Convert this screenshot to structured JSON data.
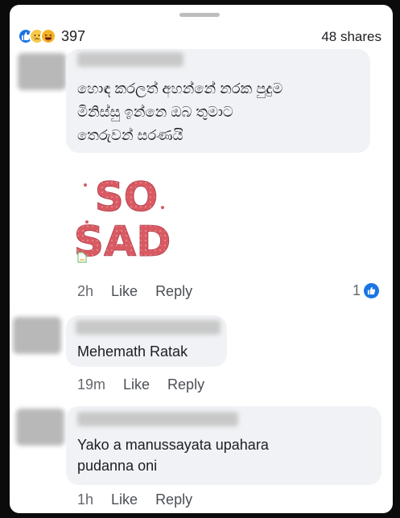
{
  "post": {
    "reaction_count": "397",
    "shares": "48 shares",
    "reaction_icons": [
      "like-icon",
      "sad-icon",
      "haha-icon"
    ]
  },
  "comments": [
    {
      "lines": [
        "හොඳ කරලත් අහන්නේ නරක පුදුම",
        "මිනිස්සු ඉන්නෙ ඔබ තුමාට",
        "තෙරුවන් සරණයි"
      ],
      "sticker_text": [
        "SO",
        "SAD"
      ],
      "time": "2h",
      "like": "Like",
      "reply": "Reply",
      "like_count": "1"
    },
    {
      "lines": [
        "Mehemath Ratak"
      ],
      "time": "19m",
      "like": "Like",
      "reply": "Reply"
    },
    {
      "lines": [
        "Yako a manussayata upahara",
        "pudanna oni"
      ],
      "time": "1h",
      "like": "Like",
      "reply": "Reply"
    }
  ],
  "colors": {
    "accent": "#1b74e4",
    "bubble": "#f0f2f5",
    "sticker": "#d95a63"
  }
}
